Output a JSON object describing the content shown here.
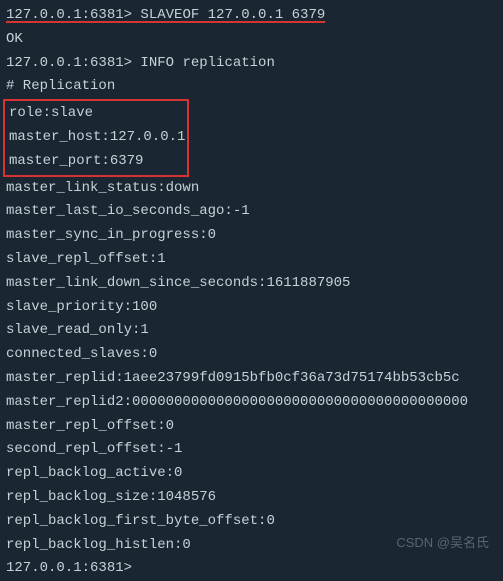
{
  "terminal": {
    "line1_prompt": "127.0.0.1:6381>",
    "line1_cmd": " SLAVEOF 127.0.0.1 6379",
    "line2": "OK",
    "line3_prompt": "127.0.0.1:6381>",
    "line3_cmd": " INFO replication",
    "line4": "# Replication",
    "boxed": {
      "role": "role:slave",
      "master_host": "master_host:127.0.0.1",
      "master_port": "master_port:6379"
    },
    "info": [
      "master_link_status:down",
      "master_last_io_seconds_ago:-1",
      "master_sync_in_progress:0",
      "slave_repl_offset:1",
      "master_link_down_since_seconds:1611887905",
      "slave_priority:100",
      "slave_read_only:1",
      "connected_slaves:0",
      "master_replid:1aee23799fd0915bfb0cf36a73d75174bb53cb5c",
      "master_replid2:0000000000000000000000000000000000000000",
      "master_repl_offset:0",
      "second_repl_offset:-1",
      "repl_backlog_active:0",
      "repl_backlog_size:1048576",
      "repl_backlog_first_byte_offset:0",
      "repl_backlog_histlen:0"
    ],
    "final_prompt": "127.0.0.1:6381>"
  },
  "watermark": "CSDN @吴名氏"
}
